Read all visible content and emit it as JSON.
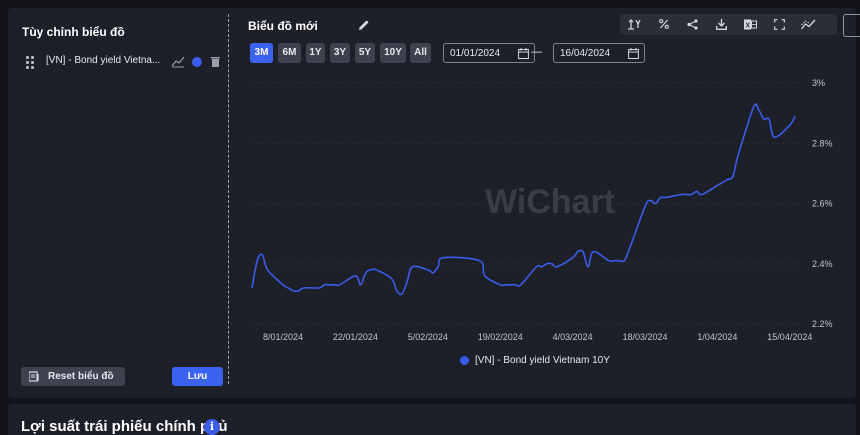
{
  "sidebar": {
    "title": "Tùy chỉnh biểu đồ",
    "series_label": "[VN] - Bond yield Vietnam 10Y",
    "series_label_short": "[VN] - Bond yield Vietna...",
    "series_color": "#3b5ce8",
    "reset_label": "Reset biểu đồ",
    "save_label": "Lưu"
  },
  "header": {
    "chart_title": "Biểu đồ mới",
    "toolbar": [
      {
        "name": "y-axis-toggle-icon",
        "glyph": "↑Y"
      },
      {
        "name": "percent-icon",
        "glyph": "%"
      },
      {
        "name": "share-icon",
        "glyph": ""
      },
      {
        "name": "download-icon",
        "glyph": ""
      },
      {
        "name": "excel-icon",
        "glyph": ""
      },
      {
        "name": "fullscreen-icon",
        "glyph": ""
      },
      {
        "name": "chart-type-icon",
        "glyph": ""
      }
    ]
  },
  "ranges": [
    {
      "label": "3M",
      "active": true
    },
    {
      "label": "6M",
      "active": false
    },
    {
      "label": "1Y",
      "active": false
    },
    {
      "label": "3Y",
      "active": false
    },
    {
      "label": "5Y",
      "active": false
    },
    {
      "label": "10Y",
      "active": false
    },
    {
      "label": "All",
      "active": false
    }
  ],
  "date_from": "01/01/2024",
  "date_to": "16/04/2024",
  "date_separator": "—",
  "watermark": "WiChart",
  "bottom": {
    "section_title": "Lợi suất trái phiếu chính phủ",
    "info_glyph": "i"
  },
  "chart_data": {
    "type": "line",
    "title": "",
    "xlabel": "",
    "ylabel": "",
    "x_ticks": [
      "8/01/2024",
      "22/01/2024",
      "5/02/2024",
      "19/02/2024",
      "4/03/2024",
      "18/03/2024",
      "1/04/2024",
      "15/04/2024"
    ],
    "y_ticks": [
      "3%",
      "2.8%",
      "2.6%",
      "2.4%",
      "2.2%"
    ],
    "ylim": [
      2.2,
      3.0
    ],
    "xlim": [
      "2024-01-02",
      "2024-04-16"
    ],
    "grid": true,
    "legend_position": "bottom-center",
    "series": [
      {
        "name": "[VN] - Bond yield Vietnam 10Y",
        "color": "#3b5ce8",
        "points": [
          [
            "2024-01-02",
            2.32
          ],
          [
            "2024-01-03",
            2.41
          ],
          [
            "2024-01-04",
            2.43
          ],
          [
            "2024-01-05",
            2.38
          ],
          [
            "2024-01-08",
            2.33
          ],
          [
            "2024-01-09",
            2.32
          ],
          [
            "2024-01-10",
            2.31
          ],
          [
            "2024-01-11",
            2.31
          ],
          [
            "2024-01-12",
            2.32
          ],
          [
            "2024-01-15",
            2.32
          ],
          [
            "2024-01-16",
            2.33
          ],
          [
            "2024-01-17",
            2.33
          ],
          [
            "2024-01-18",
            2.33
          ],
          [
            "2024-01-19",
            2.33
          ],
          [
            "2024-01-22",
            2.36
          ],
          [
            "2024-01-23",
            2.33
          ],
          [
            "2024-01-24",
            2.37
          ],
          [
            "2024-01-25",
            2.38
          ],
          [
            "2024-01-26",
            2.38
          ],
          [
            "2024-01-29",
            2.35
          ],
          [
            "2024-01-30",
            2.31
          ],
          [
            "2024-01-31",
            2.3
          ],
          [
            "2024-02-01",
            2.34
          ],
          [
            "2024-02-02",
            2.39
          ],
          [
            "2024-02-05",
            2.38
          ],
          [
            "2024-02-06",
            2.37
          ],
          [
            "2024-02-07",
            2.39
          ],
          [
            "2024-02-08",
            2.42
          ],
          [
            "2024-02-15",
            2.41
          ],
          [
            "2024-02-16",
            2.36
          ],
          [
            "2024-02-19",
            2.33
          ],
          [
            "2024-02-20",
            2.33
          ],
          [
            "2024-02-21",
            2.33
          ],
          [
            "2024-02-22",
            2.33
          ],
          [
            "2024-02-23",
            2.33
          ],
          [
            "2024-02-26",
            2.39
          ],
          [
            "2024-02-27",
            2.39
          ],
          [
            "2024-02-28",
            2.4
          ],
          [
            "2024-02-29",
            2.4
          ],
          [
            "2024-03-01",
            2.39
          ],
          [
            "2024-03-04",
            2.42
          ],
          [
            "2024-03-05",
            2.44
          ],
          [
            "2024-03-06",
            2.44
          ],
          [
            "2024-03-07",
            2.39
          ],
          [
            "2024-03-08",
            2.44
          ],
          [
            "2024-03-11",
            2.41
          ],
          [
            "2024-03-12",
            2.41
          ],
          [
            "2024-03-13",
            2.41
          ],
          [
            "2024-03-14",
            2.41
          ],
          [
            "2024-03-15",
            2.45
          ],
          [
            "2024-03-18",
            2.59
          ],
          [
            "2024-03-19",
            2.61
          ],
          [
            "2024-03-20",
            2.6
          ],
          [
            "2024-03-21",
            2.62
          ],
          [
            "2024-03-22",
            2.62
          ],
          [
            "2024-03-25",
            2.63
          ],
          [
            "2024-03-26",
            2.63
          ],
          [
            "2024-03-27",
            2.63
          ],
          [
            "2024-03-28",
            2.64
          ],
          [
            "2024-03-29",
            2.63
          ],
          [
            "2024-04-01",
            2.66
          ],
          [
            "2024-04-02",
            2.67
          ],
          [
            "2024-04-03",
            2.68
          ],
          [
            "2024-04-04",
            2.69
          ],
          [
            "2024-04-05",
            2.76
          ],
          [
            "2024-04-08",
            2.92
          ],
          [
            "2024-04-09",
            2.91
          ],
          [
            "2024-04-10",
            2.88
          ],
          [
            "2024-04-11",
            2.88
          ],
          [
            "2024-04-12",
            2.82
          ],
          [
            "2024-04-15",
            2.86
          ],
          [
            "2024-04-16",
            2.89
          ]
        ]
      }
    ]
  }
}
